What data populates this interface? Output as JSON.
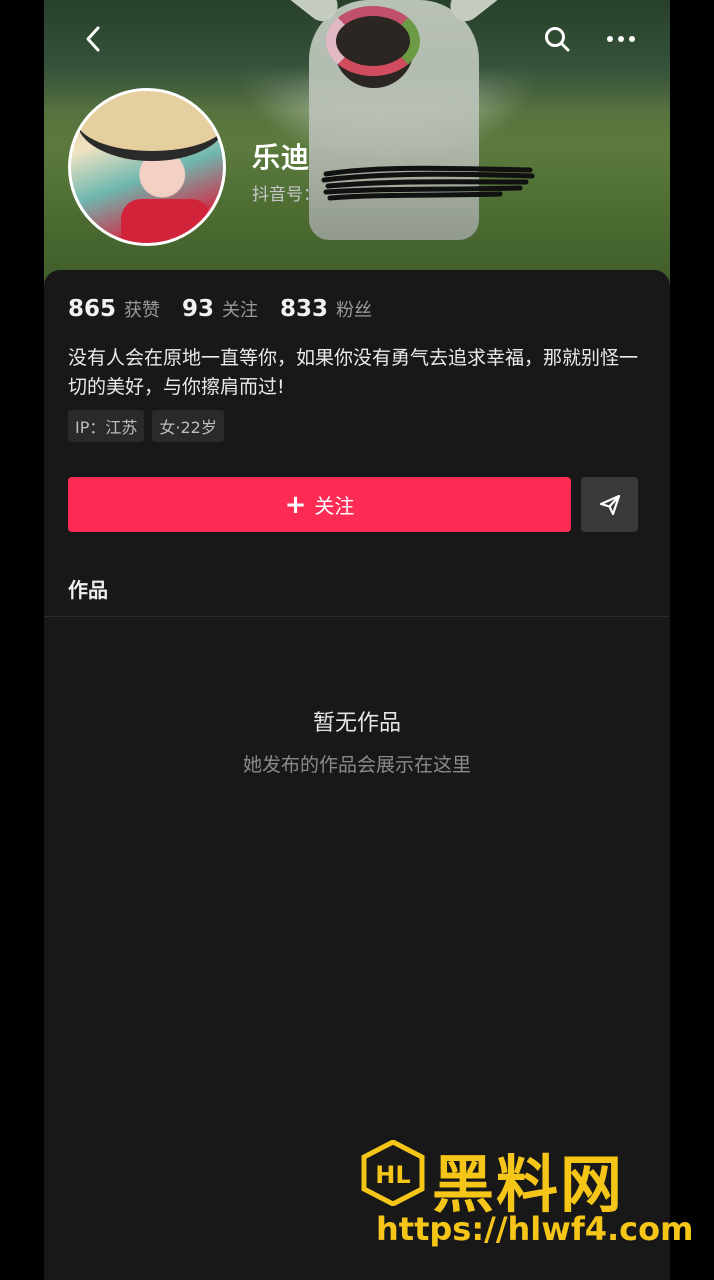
{
  "profile": {
    "name": "乐迪",
    "douyin_id_label": "抖音号：",
    "bio": "没有人会在原地一直等你，如果你没有勇气去追求幸福，那就别怪一切的美好，与你擦肩而过!",
    "tags": [
      "IP：江苏",
      "女·22岁"
    ]
  },
  "stats": [
    {
      "value": "865",
      "label": "获赞"
    },
    {
      "value": "93",
      "label": "关注"
    },
    {
      "value": "833",
      "label": "粉丝"
    }
  ],
  "actions": {
    "follow_label": "关注"
  },
  "tabs": {
    "works_label": "作品"
  },
  "empty_state": {
    "title": "暂无作品",
    "subtitle": "她发布的作品会展示在这里"
  },
  "watermark": {
    "brand": "黑料网",
    "url": "https://hlwf4.com",
    "logo_text": "HL"
  },
  "colors": {
    "accent": "#fe2c55",
    "background": "#181818",
    "watermark": "#f5c518"
  },
  "icons": [
    "chevron-left-icon",
    "search-icon",
    "more-icon",
    "plus-icon",
    "share-icon"
  ]
}
